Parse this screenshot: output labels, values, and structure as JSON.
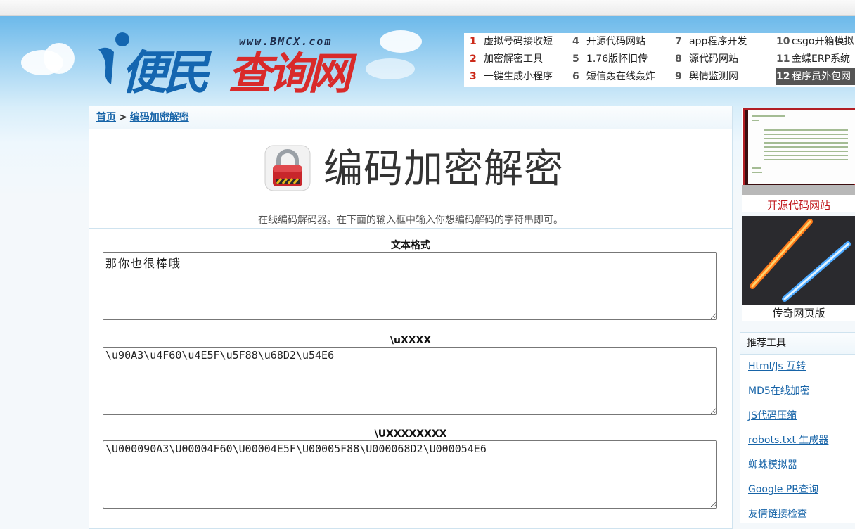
{
  "header": {
    "logo_url_text": "www.BMCX.com",
    "logo_text_blue": "便民",
    "logo_text_red": "查询网",
    "top_links": [
      {
        "num": "1",
        "label": "虚拟号码接收短"
      },
      {
        "num": "2",
        "label": "加密解密工具"
      },
      {
        "num": "3",
        "label": "一键生成小程序"
      },
      {
        "num": "4",
        "label": "开源代码网站"
      },
      {
        "num": "5",
        "label": "1.76版怀旧传"
      },
      {
        "num": "6",
        "label": "短信轰在线轰炸"
      },
      {
        "num": "7",
        "label": "app程序开发"
      },
      {
        "num": "8",
        "label": "源代码网站"
      },
      {
        "num": "9",
        "label": "舆情监测网"
      },
      {
        "num": "10",
        "label": "csgo开箱模拟"
      },
      {
        "num": "11",
        "label": "金蝶ERP系统"
      },
      {
        "num": "12",
        "label": "程序员外包网"
      }
    ]
  },
  "breadcrumb": {
    "home": "首页",
    "sep": ">",
    "current": "编码加密解密"
  },
  "page": {
    "title": "编码加密解密",
    "description": "在线编码解码器。在下面的输入框中输入你想编码解码的字符串即可。"
  },
  "fields": [
    {
      "label": "文本格式",
      "value": "那你也很棒哦"
    },
    {
      "label": "\\uXXXX",
      "value": "\\u90A3\\u4F60\\u4E5F\\u5F88\\u68D2\\u54E6"
    },
    {
      "label": "\\UXXXXXXXX",
      "value": "\\U000090A3\\U00004F60\\U00004E5F\\U00005F88\\U000068D2\\U000054E6"
    }
  ],
  "sidebar": {
    "ad1_caption": "开源代码网站",
    "ad2_caption": "传奇网页版",
    "recommend_title": "推荐工具",
    "recommend_items": [
      "Html/Js 互转",
      "MD5在线加密",
      "JS代码压缩",
      "robots.txt 生成器",
      "蜘蛛模拟器",
      "Google PR查询",
      "友情链接检查"
    ]
  },
  "colors": {
    "link": "#1764a8",
    "logo_blue": "#1466b0",
    "logo_red": "#d92a2a",
    "accent_red": "#cc2a1a"
  }
}
